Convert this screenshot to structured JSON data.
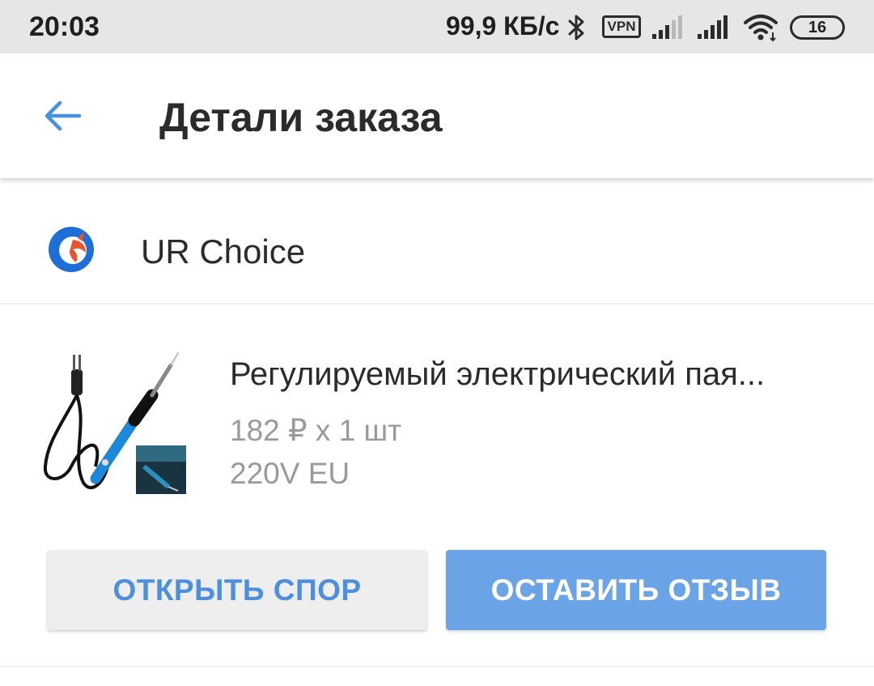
{
  "status_bar": {
    "time": "20:03",
    "speed": "99,9 КБ/с",
    "vpn_label": "VPN",
    "battery": "16",
    "icons": [
      "bluetooth-icon",
      "vpn-icon",
      "signal-icon",
      "signal-icon",
      "wifi-icon",
      "battery-icon"
    ]
  },
  "header": {
    "title": "Детали заказа",
    "back_icon": "arrow-left-icon",
    "accent_color": "#4a90e2"
  },
  "seller": {
    "name": "UR Choice"
  },
  "product": {
    "title": "Регулируемый электрический пая...",
    "price_quantity": "182 ₽ x 1 шт",
    "variant": "220V EU"
  },
  "actions": {
    "open_dispute": "ОТКРЫТЬ СПОР",
    "leave_review": "ОСТАВИТЬ ОТЗЫВ"
  },
  "colors": {
    "primary_button": "#6aa3e6",
    "secondary_button": "#eeeeee",
    "link_text": "#4b8fde"
  }
}
